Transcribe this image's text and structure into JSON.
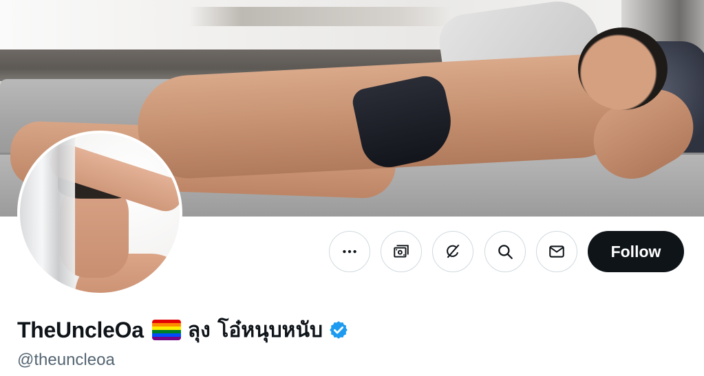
{
  "profile": {
    "display_name": "TheUncleOa",
    "thai_name": "ลุง โอ๋หนุบหนับ",
    "handle": "@theuncleoa",
    "verified": true,
    "name_emoji": "rainbow-flag"
  },
  "actions": {
    "follow_label": "Follow",
    "buttons": [
      {
        "name": "more-options",
        "icon": "ellipsis-icon"
      },
      {
        "name": "subscribe",
        "icon": "money-icon"
      },
      {
        "name": "grok",
        "icon": "grok-icon"
      },
      {
        "name": "search",
        "icon": "search-icon"
      },
      {
        "name": "message",
        "icon": "envelope-icon"
      }
    ]
  },
  "colors": {
    "text": "#0f1419",
    "secondary_text": "#536471",
    "button_border": "#cfd9de",
    "follow_bg": "#0f1419",
    "follow_text": "#ffffff",
    "verified_blue": "#1d9bf0"
  }
}
